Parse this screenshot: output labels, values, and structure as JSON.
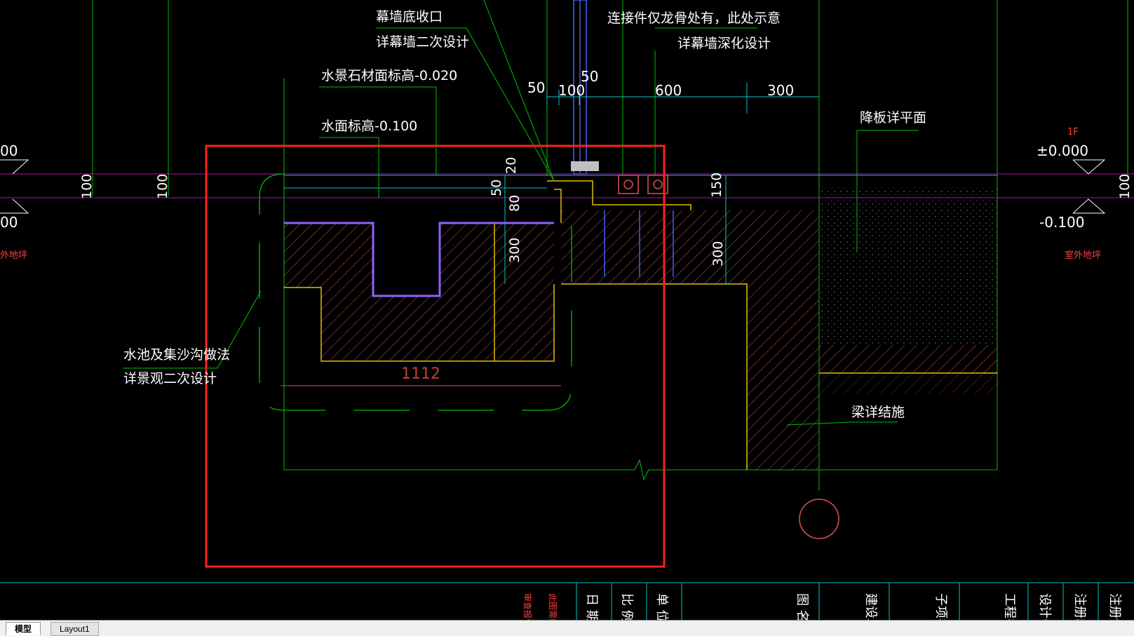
{
  "colors": {
    "background": "#000000",
    "highlight_frame": "#ff2020",
    "annotation": "#ffffff",
    "leader": "#00ff00",
    "dimension": "#00c8c8",
    "level_line": "#c800c8",
    "structure": "#ffd700",
    "hatch": "#e05050"
  },
  "annotations": {
    "curtain_bottom": "幕墙底收口",
    "curtain_bottom_sub": "详幕墙二次设计",
    "connector_note": "连接件仅龙骨处有，此处示意",
    "connector_note_sub": "详幕墙深化设计",
    "stone_elevation": "水景石材面标高-0.020",
    "water_elevation": "水面标高-0.100",
    "pool_method": "水池及集沙沟做法",
    "pool_method_sub": "详景观二次设计",
    "slab_drop": "降板详平面",
    "beam_detail": "梁详结施"
  },
  "dimensions": {
    "d50_a": "50",
    "d50_b": "50",
    "d100": "100",
    "d600": "600",
    "d300_top": "300",
    "d20": "20",
    "d50_v": "50",
    "d80": "80",
    "d300_left": "300",
    "d150": "150",
    "d300_right": "300",
    "d100_left_a": "100",
    "d100_left_b": "100",
    "d100_right": "100",
    "d1112": "1112"
  },
  "levels": {
    "left_top": "00",
    "left_bottom": "00",
    "left_floor_label": "外地坪",
    "right_floor": "1F",
    "right_top": "±0.000",
    "right_bottom": "-0.100",
    "right_floor_label": "室外地坪"
  },
  "title_block": {
    "approval_a": "审查报告",
    "approval_b": "此图需经",
    "date": "日 期",
    "scale": "比 例",
    "unit": "单 位",
    "drawing": "图 名",
    "building": "建设单",
    "subitem": "子项名",
    "project": "工程名",
    "design_no": "设计号",
    "reg_a": "注册印",
    "reg_b": "注册证"
  },
  "tabs": {
    "model": "模型",
    "layout1": "Layout1"
  }
}
